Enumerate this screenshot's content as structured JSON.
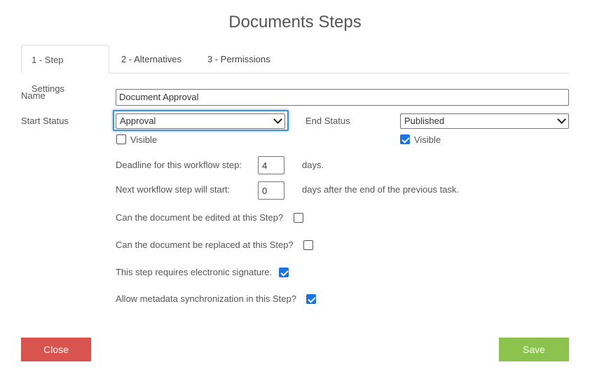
{
  "title": "Documents Steps",
  "tabs": [
    {
      "label": "1 - Step Settings",
      "active": true
    },
    {
      "label": "2 - Alternatives",
      "active": false
    },
    {
      "label": "3 - Permissions",
      "active": false
    }
  ],
  "form": {
    "name_label": "Name",
    "name_value": "Document Approval",
    "start_status_label": "Start Status",
    "start_status_value": "Approval",
    "start_visible_label": "Visible",
    "start_visible_checked": false,
    "end_status_label": "End Status",
    "end_status_value": "Published",
    "end_visible_label": "Visible",
    "end_visible_checked": true,
    "deadline_label": "Deadline for this workflow step:",
    "deadline_value": "4",
    "deadline_unit": "days.",
    "next_step_label": "Next workflow step will start:",
    "next_step_value": "0",
    "next_step_unit": "days after the end of the previous task.",
    "edited_label": "Can the document be edited at this Step?",
    "edited_checked": false,
    "replaced_label": "Can the document be replaced at this Step?",
    "replaced_checked": false,
    "signature_label": "This step requires electronic signature.",
    "signature_checked": true,
    "metadata_label": "Allow metadata synchronization in this Step?",
    "metadata_checked": true
  },
  "buttons": {
    "close_label": "Close",
    "save_label": "Save"
  },
  "colors": {
    "close": "#d9534f",
    "save": "#8cc34f",
    "checkbox_checked": "#1a73e8",
    "focus": "#3d8fd6"
  }
}
